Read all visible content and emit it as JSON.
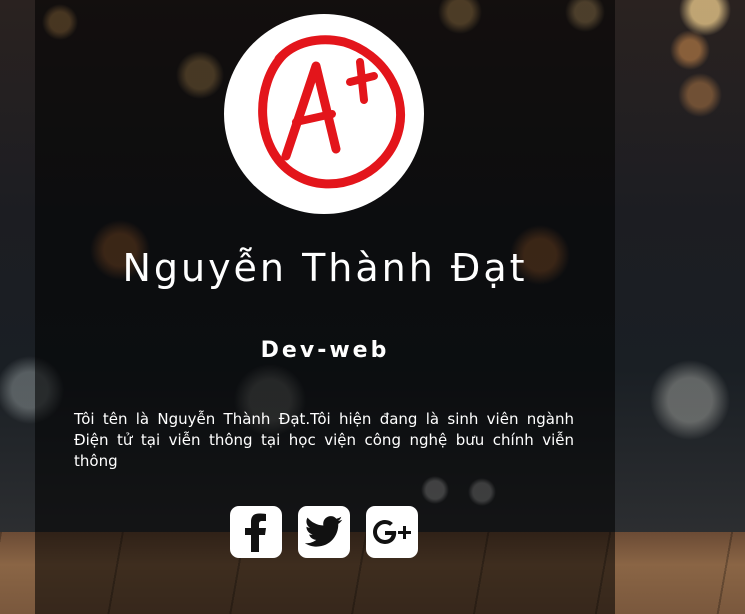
{
  "profile": {
    "avatar_icon": "a-plus-grade-icon",
    "name": "Nguyễn Thành Đạt",
    "role": "Dev-web",
    "bio": "Tôi tên là Nguyễn Thành Đạt.Tôi hiện đang là sinh viên ngành Điện tử tại viễn thông tại học viện công nghệ bưu chính viễn thông"
  },
  "social": [
    {
      "icon": "facebook-icon"
    },
    {
      "icon": "twitter-icon"
    },
    {
      "icon": "google-plus-icon"
    }
  ],
  "colors": {
    "accent": "#e3151b",
    "overlay": "rgba(0,0,0,0.55)",
    "text": "#ffffff"
  }
}
